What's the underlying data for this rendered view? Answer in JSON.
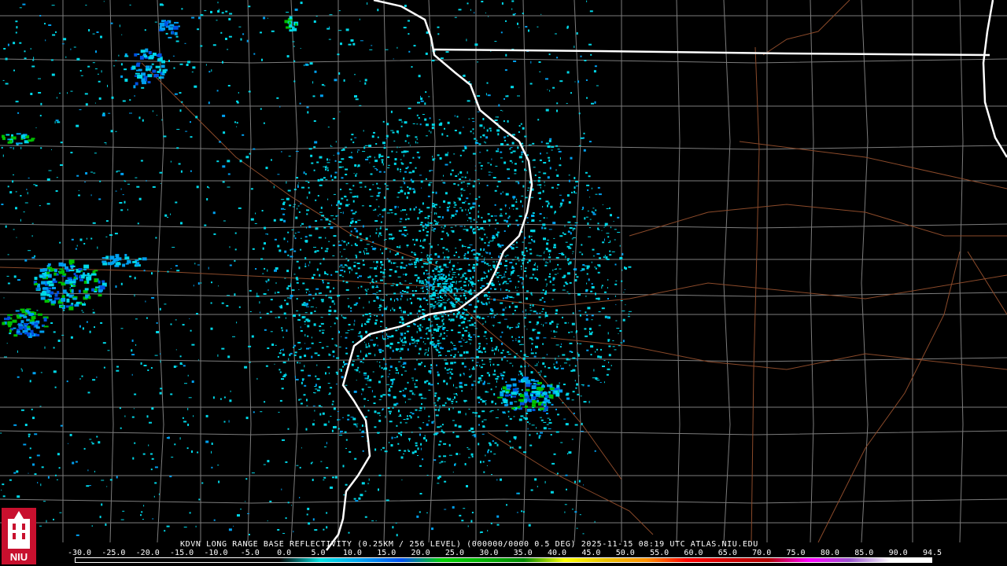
{
  "product": {
    "caption": "KDVN LONG RANGE BASE REFLECTIVITY (0.25KM / 256 LEVEL) (000000/0000 0.5 DEG) 2025-11-15 08:19 UTC  ATLAS.NIU.EDU",
    "radar_site": "KDVN",
    "logo_text": "NIU"
  },
  "legend": {
    "ticks": [
      "-30.0",
      "-25.0",
      "-20.0",
      "-15.0",
      "-10.0",
      "-5.0",
      "0.0",
      "5.0",
      "10.0",
      "15.0",
      "20.0",
      "25.0",
      "30.0",
      "35.0",
      "40.0",
      "45.0",
      "50.0",
      "55.0",
      "60.0",
      "65.0",
      "70.0",
      "75.0",
      "80.0",
      "85.0",
      "90.0",
      "94.5"
    ],
    "colors": [
      "#000000",
      "#000000",
      "#000000",
      "#000000",
      "#000000",
      "#000000",
      "#00e0e0",
      "#00a0f0",
      "#0050f0",
      "#00d000",
      "#00b000",
      "#008800",
      "#ffff00",
      "#e8c000",
      "#ff9000",
      "#ff0000",
      "#d00000",
      "#b00000",
      "#ff00ff",
      "#9955cc",
      "#ffffff",
      "#ffffff"
    ]
  },
  "map_style": {
    "background": "#000000",
    "state_border": "#ffffff",
    "county_line": "#8a8a8a",
    "highway": "#8b4a2a",
    "echo_light": "#00d8e8",
    "echo_medium": "#00a0f0",
    "echo_strong": "#0050e0",
    "echo_green": "#00c000"
  }
}
